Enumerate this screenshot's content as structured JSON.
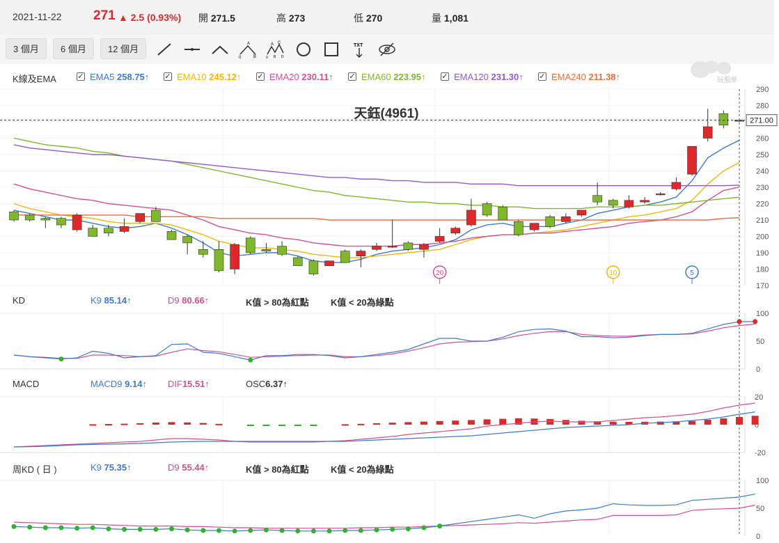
{
  "header": {
    "date": "2021-11-22",
    "price": "271",
    "change": "▲ 2.5 (0.93%)",
    "open_label": "開",
    "open": "271.5",
    "high_label": "高",
    "high": "273",
    "low_label": "低",
    "low": "270",
    "volume_label": "量",
    "volume": "1,081"
  },
  "toolbar": {
    "periods": [
      "3 個月",
      "6 個月",
      "12 個月"
    ],
    "tools": [
      "line-tool-icon",
      "horizontal-line-icon",
      "angle-line-icon",
      "pattern-abc-icon",
      "wave-abcd-icon",
      "circle-tool-icon",
      "rectangle-tool-icon",
      "text-tool-icon",
      "hide-eye-icon"
    ],
    "tool_text": {
      "abc": [
        "A",
        "B",
        "0"
      ],
      "abcd": [
        "A",
        "C",
        "0",
        "B",
        "D"
      ],
      "txt": "TXT"
    }
  },
  "logo_text": "玩股網",
  "ema": {
    "title": "K線及EMA",
    "items": [
      {
        "name": "EMA5",
        "value": "258.75↑",
        "color": "#3c7ad6"
      },
      {
        "name": "EMA10",
        "value": "245.12↑",
        "color": "#f2b705"
      },
      {
        "name": "EMA20",
        "value": "230.11↑",
        "color": "#d94f8c"
      },
      {
        "name": "EMA60",
        "value": "223.95↑",
        "color": "#7fb82a"
      },
      {
        "name": "EMA120",
        "value": "231.30↑",
        "color": "#8e5bd6"
      },
      {
        "name": "EMA240",
        "value": "211.38↑",
        "color": "#f26b3a"
      }
    ]
  },
  "kd": {
    "title": "KD",
    "k_label": "K9",
    "k_value": "85.14↑",
    "d_label": "D9",
    "d_value": "80.66↑",
    "note1": "K值 > 80為紅點",
    "note2": "K值 < 20為綠點"
  },
  "macd": {
    "title": "MACD",
    "macd_label": "MACD9",
    "macd_value": "9.14↑",
    "dif_label": "DIF",
    "dif_value": "15.51↑",
    "osc_label": "OSC",
    "osc_value": "6.37↑"
  },
  "weekly_kd": {
    "title": "周KD ( 日 )",
    "k_label": "K9",
    "k_value": "75.35↑",
    "d_label": "D9",
    "d_value": "55.44↑",
    "note1": "K值 > 80為紅點",
    "note2": "K值 < 20為綠點"
  },
  "colors": {
    "up": "#e0272a",
    "down": "#7fb82a",
    "blue": "#3c7ad6",
    "pink": "#d94f8c"
  },
  "chart_data": {
    "type": "candlestick",
    "title": "天鈺(4961)",
    "current_price_label": "271.00",
    "price_ticks": [
      170,
      180,
      190,
      200,
      210,
      220,
      230,
      240,
      250,
      260,
      270,
      280,
      290
    ],
    "ylim": [
      170,
      290
    ],
    "markers": [
      {
        "label": "20",
        "index": 27,
        "color": "#d94f8c"
      },
      {
        "label": "10",
        "index": 38,
        "color": "#f2b705"
      },
      {
        "label": "5",
        "index": 43,
        "color": "#3c7ad6"
      }
    ],
    "candles": [
      {
        "o": 215,
        "h": 216,
        "l": 209,
        "c": 210
      },
      {
        "o": 213,
        "h": 214,
        "l": 209,
        "c": 210
      },
      {
        "o": 211,
        "h": 212,
        "l": 205,
        "c": 210
      },
      {
        "o": 211,
        "h": 212,
        "l": 205,
        "c": 207
      },
      {
        "o": 204,
        "h": 214,
        "l": 203,
        "c": 213
      },
      {
        "o": 205,
        "h": 207,
        "l": 200,
        "c": 200
      },
      {
        "o": 205,
        "h": 207,
        "l": 200,
        "c": 202
      },
      {
        "o": 203,
        "h": 211,
        "l": 202,
        "c": 206
      },
      {
        "o": 209,
        "h": 214,
        "l": 208,
        "c": 214
      },
      {
        "o": 216,
        "h": 218,
        "l": 209,
        "c": 209
      },
      {
        "o": 203,
        "h": 204,
        "l": 198,
        "c": 198
      },
      {
        "o": 200,
        "h": 201,
        "l": 189,
        "c": 196
      },
      {
        "o": 192,
        "h": 197,
        "l": 187,
        "c": 189
      },
      {
        "o": 192,
        "h": 197,
        "l": 178,
        "c": 179
      },
      {
        "o": 180,
        "h": 196,
        "l": 177,
        "c": 195
      },
      {
        "o": 199,
        "h": 200,
        "l": 189,
        "c": 190
      },
      {
        "o": 192,
        "h": 196,
        "l": 190,
        "c": 191
      },
      {
        "o": 194,
        "h": 197,
        "l": 188,
        "c": 189
      },
      {
        "o": 187,
        "h": 188,
        "l": 182,
        "c": 182
      },
      {
        "o": 185,
        "h": 186,
        "l": 176,
        "c": 177
      },
      {
        "o": 182,
        "h": 185,
        "l": 182,
        "c": 185
      },
      {
        "o": 191,
        "h": 192,
        "l": 184,
        "c": 184
      },
      {
        "o": 188,
        "h": 192,
        "l": 181,
        "c": 191
      },
      {
        "o": 192,
        "h": 196,
        "l": 191,
        "c": 194
      },
      {
        "o": 194,
        "h": 210,
        "l": 193,
        "c": 194
      },
      {
        "o": 196,
        "h": 197,
        "l": 191,
        "c": 192
      },
      {
        "o": 192,
        "h": 196,
        "l": 187,
        "c": 195
      },
      {
        "o": 197,
        "h": 205,
        "l": 196,
        "c": 200
      },
      {
        "o": 202,
        "h": 206,
        "l": 201,
        "c": 205
      },
      {
        "o": 207,
        "h": 223,
        "l": 206,
        "c": 216
      },
      {
        "o": 220,
        "h": 221,
        "l": 212,
        "c": 213
      },
      {
        "o": 218,
        "h": 219,
        "l": 210,
        "c": 210
      },
      {
        "o": 209,
        "h": 210,
        "l": 200,
        "c": 201
      },
      {
        "o": 204,
        "h": 208,
        "l": 203,
        "c": 208
      },
      {
        "o": 212,
        "h": 213,
        "l": 205,
        "c": 206
      },
      {
        "o": 209,
        "h": 214,
        "l": 208,
        "c": 212
      },
      {
        "o": 213,
        "h": 216,
        "l": 212,
        "c": 216
      },
      {
        "o": 225,
        "h": 233,
        "l": 219,
        "c": 221
      },
      {
        "o": 222,
        "h": 223,
        "l": 217,
        "c": 219
      },
      {
        "o": 218,
        "h": 225,
        "l": 217,
        "c": 222
      },
      {
        "o": 221,
        "h": 224,
        "l": 220,
        "c": 222
      },
      {
        "o": 226,
        "h": 227,
        "l": 225,
        "c": 226
      },
      {
        "o": 229,
        "h": 236,
        "l": 228,
        "c": 233
      },
      {
        "o": 238,
        "h": 255,
        "l": 237,
        "c": 255
      },
      {
        "o": 260,
        "h": 278,
        "l": 258,
        "c": 267
      },
      {
        "o": 275,
        "h": 277,
        "l": 266,
        "c": 268
      },
      {
        "o": 271,
        "h": 272,
        "l": 270,
        "c": 271
      }
    ],
    "ema_series": {
      "EMA5": [
        216,
        214,
        212,
        210,
        210,
        208,
        206,
        205,
        206,
        208,
        205,
        201,
        196,
        190,
        188,
        189,
        190,
        190,
        188,
        185,
        184,
        184,
        186,
        189,
        191,
        192,
        193,
        195,
        198,
        204,
        207,
        208,
        206,
        206,
        206,
        208,
        210,
        214,
        216,
        218,
        219,
        221,
        224,
        234,
        248,
        254,
        258.75
      ],
      "EMA10": [
        220,
        217,
        215,
        213,
        212,
        211,
        209,
        208,
        208,
        208,
        207,
        204,
        201,
        197,
        195,
        193,
        193,
        192,
        191,
        189,
        188,
        187,
        187,
        188,
        189,
        190,
        191,
        192,
        195,
        198,
        200,
        201,
        201,
        202,
        203,
        204,
        206,
        208,
        210,
        212,
        213,
        215,
        217,
        222,
        232,
        240,
        245.12
      ],
      "EMA20": [
        232,
        229,
        227,
        225,
        223,
        222,
        220,
        219,
        218,
        217,
        216,
        213,
        210,
        206,
        204,
        202,
        201,
        199,
        198,
        196,
        195,
        194,
        194,
        194,
        194,
        195,
        195,
        196,
        197,
        199,
        200,
        201,
        201,
        202,
        202,
        203,
        204,
        205,
        206,
        208,
        209,
        210,
        212,
        215,
        222,
        228,
        230.11
      ],
      "EMA60": [
        260,
        258,
        256,
        255,
        254,
        252,
        251,
        249,
        248,
        247,
        246,
        244,
        242,
        240,
        238,
        236,
        234,
        232,
        230,
        228,
        227,
        225,
        224,
        223,
        222,
        221,
        221,
        220,
        220,
        219,
        219,
        218,
        218,
        217,
        217,
        217,
        217,
        218,
        218,
        218,
        219,
        219,
        220,
        221,
        222,
        223,
        223.95
      ],
      "EMA120": [
        256,
        254,
        253,
        252,
        251,
        250,
        250,
        249,
        248,
        247,
        246,
        245,
        244,
        243,
        242,
        241,
        240,
        239,
        238,
        237,
        236,
        236,
        235,
        235,
        234,
        234,
        233,
        233,
        233,
        232,
        232,
        232,
        231,
        231,
        231,
        231,
        231,
        231,
        231,
        231,
        231,
        231,
        231,
        231,
        231,
        231,
        231.3
      ],
      "EMA240": [
        213,
        213,
        213,
        213,
        213,
        213,
        213,
        213,
        212,
        212,
        212,
        212,
        212,
        211,
        211,
        211,
        211,
        211,
        211,
        211,
        210,
        210,
        210,
        210,
        210,
        210,
        210,
        210,
        210,
        210,
        210,
        210,
        210,
        210,
        210,
        210,
        210,
        210,
        210,
        210,
        210,
        210,
        210,
        210,
        210,
        211,
        211.38
      ]
    },
    "kd_ticks": [
      0,
      50,
      100
    ],
    "kd_k": [
      25,
      22,
      20,
      18,
      20,
      32,
      28,
      20,
      22,
      24,
      44,
      45,
      30,
      28,
      22,
      16,
      24,
      24,
      26,
      26,
      24,
      20,
      22,
      26,
      30,
      35,
      45,
      55,
      55,
      50,
      50,
      57,
      67,
      71,
      72,
      68,
      58,
      58,
      56,
      57,
      60,
      62,
      62,
      64,
      72,
      80,
      85,
      85.14
    ],
    "kd_d": [
      25,
      22,
      21,
      19,
      19,
      25,
      25,
      24,
      22,
      23,
      30,
      36,
      33,
      31,
      26,
      21,
      22,
      23,
      24,
      25,
      25,
      22,
      22,
      24,
      27,
      32,
      38,
      45,
      48,
      49,
      50,
      54,
      60,
      64,
      67,
      67,
      62,
      60,
      59,
      59,
      61,
      62,
      62,
      63,
      68,
      74,
      78,
      80.66
    ],
    "macd_ticks": [
      -20,
      0,
      20
    ],
    "macd_dif": [
      -16,
      -15.5,
      -15,
      -14.5,
      -14,
      -13.5,
      -13,
      -12.5,
      -12,
      -11,
      -10,
      -10,
      -10.5,
      -11,
      -12,
      -12.5,
      -12.5,
      -12.5,
      -12.5,
      -12.5,
      -12,
      -11.5,
      -10.5,
      -9.5,
      -8.5,
      -7,
      -6,
      -5,
      -4,
      -3,
      -1,
      0,
      1,
      2,
      2.5,
      2,
      2,
      2,
      3,
      4,
      5,
      5.5,
      6.5,
      7.5,
      9.5,
      12,
      14,
      15.51
    ],
    "macd_macd": [
      -16,
      -15.8,
      -15.5,
      -15,
      -14.5,
      -14.2,
      -14,
      -13.8,
      -13.5,
      -13,
      -12.5,
      -12.2,
      -12,
      -12,
      -12,
      -12,
      -12,
      -12,
      -12,
      -12,
      -12,
      -12,
      -11.5,
      -11,
      -10.5,
      -10,
      -9.5,
      -9,
      -8.5,
      -8,
      -7,
      -6,
      -5,
      -4,
      -3,
      -2,
      -1.5,
      -1,
      -0.5,
      0,
      1,
      1.5,
      2,
      3,
      4,
      5.5,
      7.5,
      9.14
    ],
    "macd_osc": [
      0,
      0,
      0,
      0,
      0,
      0.3,
      0.5,
      0.7,
      1,
      1.5,
      1.8,
      1.6,
      1.2,
      0.6,
      0,
      -0.3,
      -0.3,
      -0.3,
      -0.3,
      -0.3,
      0,
      0.3,
      0.6,
      1,
      1.4,
      1.8,
      2.2,
      2.6,
      2.9,
      3.3,
      3.8,
      4.2,
      4.6,
      4.4,
      4,
      3.4,
      2.8,
      2.4,
      2,
      2,
      2,
      2.2,
      2.4,
      2.6,
      3.5,
      4.5,
      5.5,
      6.37
    ],
    "wkd_ticks": [
      0,
      50,
      100
    ],
    "wkd_k": [
      17,
      16,
      15,
      15,
      14,
      15,
      13,
      12,
      12,
      12,
      13,
      11,
      10,
      10,
      9,
      10,
      11,
      10,
      9,
      9,
      9,
      10,
      10,
      11,
      12,
      13,
      15,
      18,
      22,
      26,
      30,
      34,
      38,
      32,
      40,
      45,
      47,
      50,
      58,
      56,
      55,
      55,
      56,
      64,
      66,
      68,
      70,
      75.35
    ],
    "wkd_d": [
      25,
      24,
      23,
      22,
      21,
      21,
      20,
      19,
      18,
      18,
      18,
      17,
      17,
      16,
      15,
      15,
      14,
      14,
      14,
      14,
      14,
      14,
      15,
      15,
      16,
      16,
      17,
      18,
      19,
      20,
      21,
      22,
      24,
      23,
      25,
      27,
      29,
      30,
      37,
      37,
      37,
      37,
      38,
      46,
      48,
      49,
      50,
      55.44
    ]
  }
}
